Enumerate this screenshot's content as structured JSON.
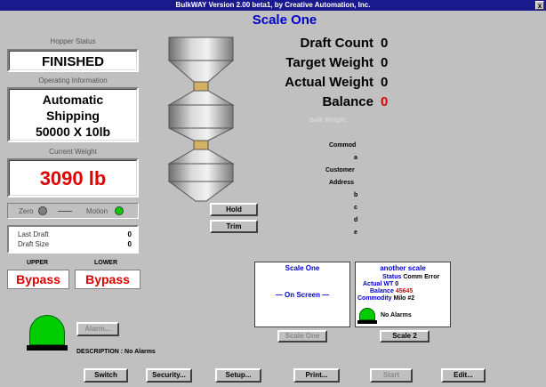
{
  "window": {
    "title": "BulkWAY Version 2.00 beta1, by Creative Automation, Inc.",
    "close_glyph": "x"
  },
  "scale_title": "Scale One",
  "hopper": {
    "label": "Hopper Status",
    "value": "FINISHED"
  },
  "operating": {
    "label": "Operating Information",
    "line1": "Automatic",
    "line2": "Shipping",
    "line3": "50000 X 10lb"
  },
  "weight": {
    "label": "Current Weight",
    "value": "3090 lb"
  },
  "indicators": {
    "zero_label": "Zero",
    "motion_label": "Motion",
    "zero_color": "#808080",
    "motion_color": "#00cc00"
  },
  "draft": {
    "last_label": "Last Draft",
    "last_value": "0",
    "size_label": "Draft Size",
    "size_value": "0"
  },
  "bypass": {
    "upper_label": "UPPER",
    "lower_label": "LOWER",
    "upper_value": "Bypass",
    "lower_value": "Bypass"
  },
  "stats": {
    "draft_count_label": "Draft Count",
    "draft_count": "0",
    "target_weight_label": "Target Weight",
    "target_weight": "0",
    "actual_weight_label": "Actual Weight",
    "actual_weight": "0",
    "balance_label": "Balance",
    "balance": "0",
    "bulk_weight_label": "Bulk Weight"
  },
  "info_labels": {
    "commod": "Commod",
    "a": "a",
    "customer": "Customer",
    "address": "Address",
    "b": "b",
    "c": "c",
    "d": "d",
    "e": "e"
  },
  "controls": {
    "hold": "Hold",
    "trim": "Trim"
  },
  "panel_one": {
    "title": "Scale One",
    "status": "— On Screen —",
    "button": "Scale One"
  },
  "panel_two": {
    "title": "another scale",
    "status_label": "Status",
    "status_value": "Comm Error",
    "actual_label": "Actual WT",
    "actual_value": "0",
    "balance_label": "Balance",
    "balance_value": "45645",
    "commodity_label": "Commodity",
    "commodity_value": "Milo #2",
    "alarms": "No Alarms",
    "button": "Scale 2"
  },
  "alarm": {
    "button": "Alarm...",
    "description": "DESCRIPTION : No Alarms",
    "light_color": "#00cc00"
  },
  "bottom_buttons": {
    "switch": "Switch",
    "security": "Security...",
    "setup": "Setup...",
    "print": "Print...",
    "start": "Start",
    "edit": "Edit..."
  }
}
